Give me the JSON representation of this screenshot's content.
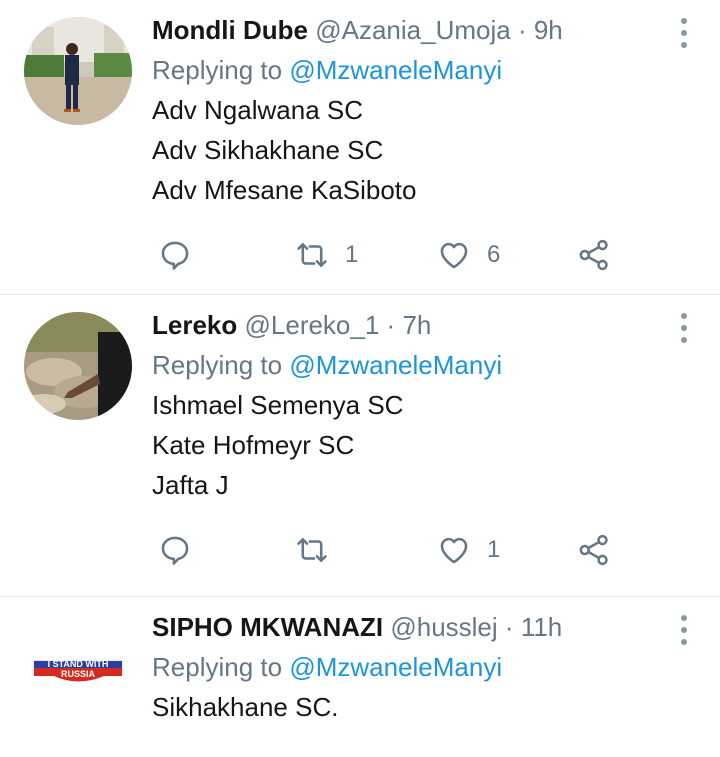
{
  "tweets": [
    {
      "name": "Mondli Dube",
      "handle": "@Azania_Umoja",
      "dot": "·",
      "time": "9h",
      "replying_prefix": "Replying to ",
      "replying_to": "@MzwaneleManyi",
      "lines": [
        "Adv Ngalwana SC",
        "Adv Sikhakhane SC",
        "Adv Mfesane KaSiboto"
      ],
      "retweets": "1",
      "likes": "6"
    },
    {
      "name": "Lereko",
      "handle": "@Lereko_1",
      "dot": "·",
      "time": "7h",
      "replying_prefix": "Replying to ",
      "replying_to": "@MzwaneleManyi",
      "lines": [
        "Ishmael Semenya SC",
        "Kate Hofmeyr SC",
        "Jafta J"
      ],
      "retweets": "",
      "likes": "1"
    },
    {
      "name": "SIPHO MKWANAZI",
      "handle": "@husslej",
      "dot": "·",
      "time": "11h",
      "replying_prefix": "Replying to ",
      "replying_to": "@MzwaneleManyi",
      "lines": [
        "Sikhakhane SC."
      ],
      "avatar_text": [
        "I STAND WITH",
        "RUSSIA"
      ]
    }
  ],
  "colors": {
    "accent": "#1b95e0",
    "secondary_text": "#657786",
    "icon": "#657786"
  },
  "icons": {
    "reply": "reply-bubble-icon",
    "retweet": "retweet-icon",
    "like": "heart-icon",
    "share": "share-icon",
    "more": "more-vertical-icon"
  }
}
